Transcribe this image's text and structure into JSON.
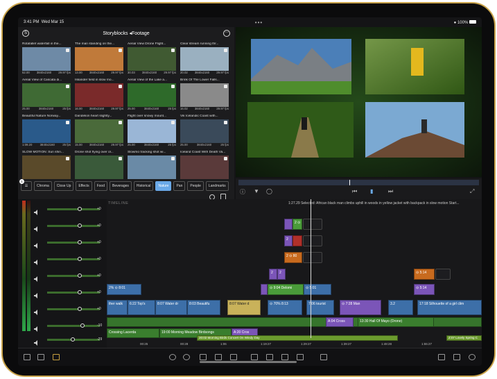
{
  "status": {
    "time": "3:41 PM",
    "date": "Wed Mar 15",
    "battery": "100%",
    "dots": "•••"
  },
  "browser": {
    "title": "Storyblocks ◂Footage",
    "logo": "S",
    "more": "⋯",
    "filter_count": "1",
    "clips": [
      {
        "title": "Rotafallet waterfall in the...",
        "dur": "52.00",
        "res": "3840x2160",
        "fps": "29.97 fps"
      },
      {
        "title": "The man standing on the...",
        "dur": "13.00",
        "res": "3840x2160",
        "fps": "29.97 fps"
      },
      {
        "title": "Aerial View Drone Flight...",
        "dur": "30.03",
        "res": "3840x2160",
        "fps": "29.97 fps"
      },
      {
        "title": "Clear stream running thr...",
        "dur": "20.02",
        "res": "3840x2160",
        "fps": "29.97 fps"
      },
      {
        "title": "Aerial View of Cascata di...",
        "dur": "25.00",
        "res": "3840x2160",
        "fps": "25 fps"
      },
      {
        "title": "Iskander field in slow mo...",
        "dur": "16.00",
        "res": "3840x2160",
        "fps": "29.97 fps"
      },
      {
        "title": "Aerial View of the Lake a...",
        "dur": "25.00",
        "res": "3840x2160",
        "fps": "25 fps"
      },
      {
        "title": "Brink Of The Lower Falls...",
        "dur": "16.02",
        "res": "3840x2160",
        "fps": "29.97 fps"
      },
      {
        "title": "Beautiful Nature Norway...",
        "dur": "1:09.20",
        "res": "3840x2160",
        "fps": "25 fps"
      },
      {
        "title": "Dandelion heart slightly...",
        "dur": "15.00",
        "res": "3840x2160",
        "fps": "29.97 fps"
      },
      {
        "title": "Flight over snowy mount...",
        "dur": "25.00",
        "res": "3840x2160",
        "fps": "25 fps"
      },
      {
        "title": "Vik Icelandic Coast with...",
        "dur": "25.00",
        "res": "3840x2160",
        "fps": "25 fps"
      },
      {
        "title": "SLOW MOTION: Sun shin...",
        "dur": "",
        "res": "",
        "fps": ""
      },
      {
        "title": "Drone shot flying over ol...",
        "dur": "",
        "res": "",
        "fps": ""
      },
      {
        "title": "Slowmo tracking shot wi...",
        "dur": "",
        "res": "",
        "fps": ""
      },
      {
        "title": "Iceland Coast With Death Va...",
        "dur": "",
        "res": "",
        "fps": ""
      }
    ],
    "filters": [
      "Chroma",
      "Close Up",
      "Effects",
      "Food",
      "Beverages",
      "Historical",
      "Nature",
      "Pan",
      "People",
      "Landmarks"
    ],
    "selected_filter": "Nature"
  },
  "timeline": {
    "label": "TIMELINE",
    "info": "1:27.29 Selected: African black man climbs uphill in woods in yellow jacket with backpack in slow motion Start...",
    "pan": [
      "+0",
      "+0",
      "+0",
      "+0",
      "+0",
      "+0",
      "+0",
      "-10",
      "-29",
      "+0"
    ],
    "clips": {
      "r1": "2 ⊙ 1 5",
      "r2": "2",
      "r3": "2 ⊙ 80",
      "r4a": "2",
      "r4b": "2",
      "c514": "⊙ 5:14",
      "c514b": "⊙ 5:14",
      "v1": "2% ⊙ 8:01",
      "v2": "⊙ 9:04  Delomi",
      "v3": "⊙ 5:01",
      "m1": "ther walk",
      "m2": "6:22  Top's",
      "m3": "8:07  Water dr",
      "m4": "8:03  Beautifu",
      "m5": "8:07  Water d",
      "m6": "⊙ 70%  8:13",
      "m7": "7:06  tourist",
      "m8": "⊙ 7:28  Man",
      "m9": "3.2",
      "m10": "17:18  Silhouette of a girl clim",
      "a1": "A:04  Cross",
      "a2": "13:30  Hall Of Mayo (Drone)",
      "a3": "Crossing  Lacerda",
      "a4": "19:00  Morning Meadow Birdsongs",
      "a5": "A:20  Cros",
      "a6": "20:02  Morning Birds Concert On Windy Day",
      "a7": "Z:07  Lovely Spring C"
    },
    "ruler": [
      "00:25",
      "00:28",
      "1:06",
      "1:19:27",
      "1:29:27",
      "1:39:27",
      "1:48:28",
      "1:55:27"
    ]
  },
  "colors": {
    "accent": "#6aa9e8",
    "purple": "#7b55b8",
    "blue": "#3d6fa8",
    "green": "#4a9b3a",
    "orange": "#c86a1e",
    "red": "#b0302a"
  }
}
